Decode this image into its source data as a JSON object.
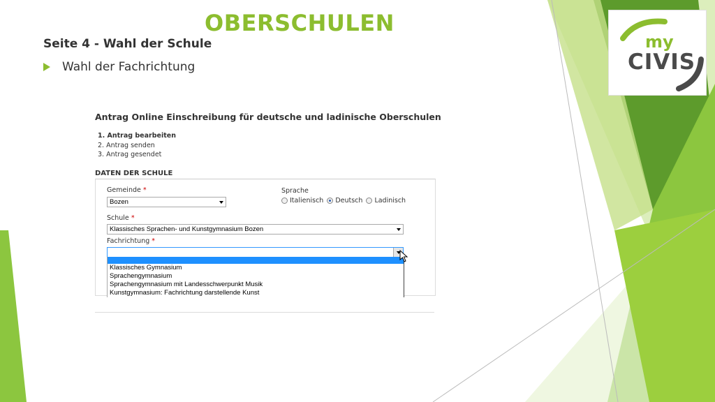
{
  "slide": {
    "title": "OBERSCHULEN",
    "subtitle": "Seite 4 - Wahl der Schule",
    "bullet": "Wahl der Fachrichtung",
    "colors": {
      "accent": "#8cbd2f",
      "dark_green": "#5d9b2c",
      "text": "#333333"
    }
  },
  "logo": {
    "my": "my",
    "civis": "CIVIS"
  },
  "form": {
    "title": "Antrag Online Einschreibung für deutsche und ladinische Oberschulen",
    "steps": [
      "1. Antrag bearbeiten",
      "2. Antrag senden",
      "3. Antrag gesendet"
    ],
    "section": "DATEN DER SCHULE",
    "gemeinde": {
      "label": "Gemeinde",
      "value": "Bozen"
    },
    "sprache": {
      "label": "Sprache",
      "options": [
        "Italienisch",
        "Deutsch",
        "Ladinisch"
      ],
      "selected": "Deutsch"
    },
    "schule": {
      "label": "Schule",
      "value": "Klassisches Sprachen- und Kunstgymnasium Bozen"
    },
    "fachrichtung": {
      "label": "Fachrichtung",
      "value": "",
      "options": [
        "Klassisches Gymnasium",
        "Sprachengymnasium",
        "Sprachengymnasium mit Landesschwerpunkt Musik",
        "Kunstgymnasium: Fachrichtung darstellende Kunst"
      ]
    },
    "required_mark": "*"
  }
}
